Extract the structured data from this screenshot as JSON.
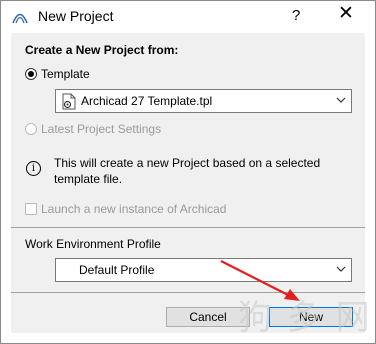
{
  "window": {
    "title": "New Project",
    "help_label": "?",
    "close_label": "✕"
  },
  "form": {
    "heading": "Create a New Project from:",
    "template_option": {
      "label": "Template",
      "selected": true
    },
    "template_dropdown": {
      "value": "Archicad 27 Template.tpl",
      "icon": "template-file-icon"
    },
    "latest_settings_option": {
      "label": "Latest Project Settings",
      "selected": false,
      "enabled": false
    },
    "info": {
      "icon": "info-icon",
      "glyph": "i",
      "text": "This will create a new Project based on a selected template file."
    },
    "launch_checkbox": {
      "label": "Launch a new instance of Archicad",
      "checked": false,
      "enabled": false
    },
    "work_env": {
      "label": "Work Environment Profile",
      "value": "Default Profile"
    }
  },
  "buttons": {
    "cancel": "Cancel",
    "new": "New"
  },
  "colors": {
    "content_bg": "#f0f0f0",
    "accent": "#0078d7",
    "annotation_arrow": "#e02020"
  },
  "watermark": "狗 多 网"
}
